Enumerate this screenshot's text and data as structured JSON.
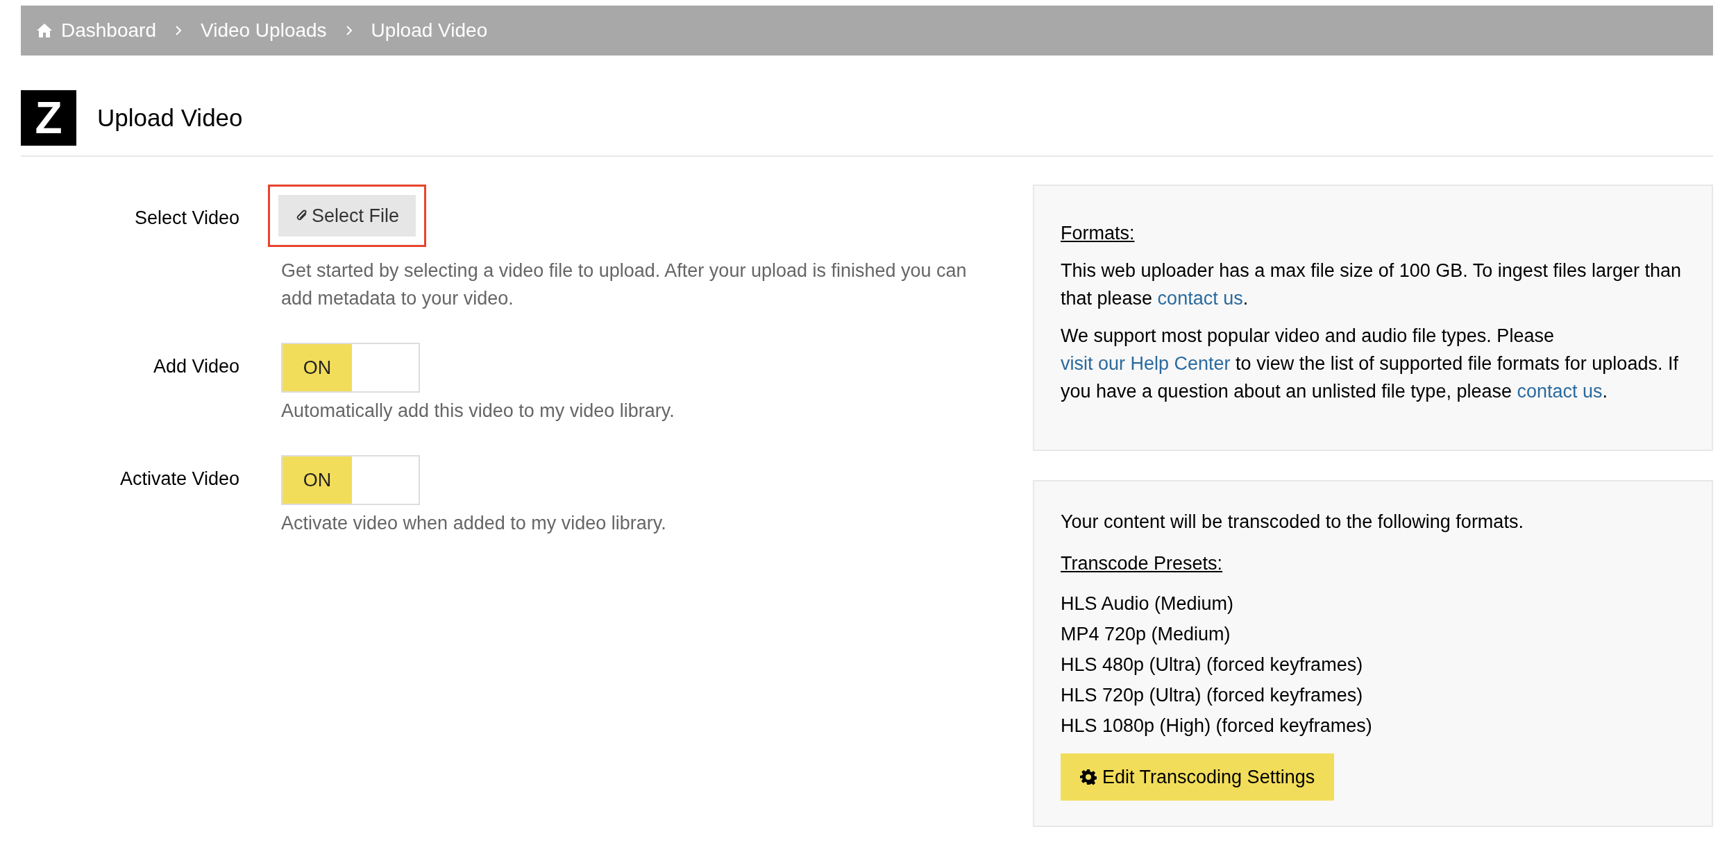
{
  "breadcrumb": [
    {
      "label": "Dashboard",
      "kind": "home"
    },
    {
      "label": "Video Uploads",
      "kind": "link"
    },
    {
      "label": "Upload Video",
      "kind": "current"
    }
  ],
  "logo": {
    "letter": "Z"
  },
  "title": "Upload Video",
  "form": [
    {
      "kind": "file",
      "label": "Select Video",
      "button": "Select File",
      "highlighted": true,
      "help": "Get started by selecting a video file to upload. After your upload is finished you can add metadata to your video."
    },
    {
      "kind": "toggle",
      "label": "Add Video",
      "toggle_label": "ON",
      "on": true,
      "help": "Automatically add this video to my video library."
    },
    {
      "kind": "toggle",
      "label": "Activate Video",
      "toggle_label": "ON",
      "on": true,
      "help": "Activate video when added to my video library."
    }
  ],
  "formats_panel": {
    "heading": "Formats:",
    "paragraphs": [
      [
        {
          "text": "This web uploader has a max file size of 100 GB. To ingest files larger than that please ",
          "kind": "text"
        },
        {
          "text": "contact us",
          "kind": "link"
        },
        {
          "text": ".",
          "kind": "text"
        }
      ],
      [
        {
          "text": "We support most popular video and audio file types. Please ",
          "kind": "text"
        },
        {
          "text": "visit our Help Center",
          "kind": "link"
        },
        {
          "text": " to view the list of supported file formats for uploads. If you have a question about an unlisted file type, please ",
          "kind": "text"
        },
        {
          "text": "contact us",
          "kind": "link"
        },
        {
          "text": ".",
          "kind": "text"
        }
      ]
    ]
  },
  "transcode_panel": {
    "intro": "Your content will be transcoded to the following formats.",
    "heading": "Transcode Presets:",
    "presets": [
      "HLS Audio (Medium)",
      "MP4 720p (Medium)",
      "HLS 480p (Ultra) (forced keyframes)",
      "HLS 720p (Ultra) (forced keyframes)",
      "HLS 1080p (High) (forced keyframes)"
    ],
    "button": "Edit Transcoding Settings"
  }
}
